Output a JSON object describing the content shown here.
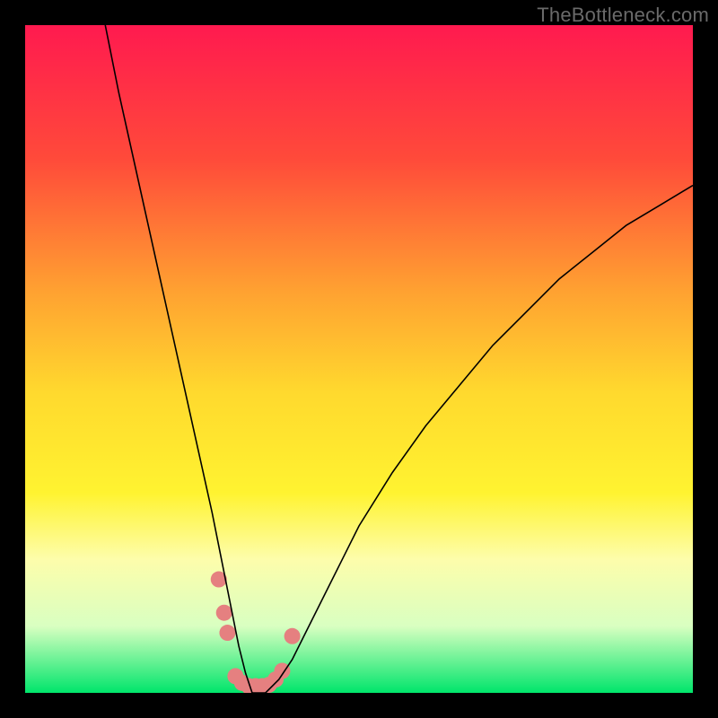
{
  "watermark": "TheBottleneck.com",
  "chart_data": {
    "type": "line",
    "title": "",
    "xlabel": "",
    "ylabel": "",
    "xlim": [
      0,
      100
    ],
    "ylim": [
      0,
      100
    ],
    "grid": false,
    "legend": false,
    "background_gradient_y_to_color": [
      [
        0,
        "#ff1a4f"
      ],
      [
        20,
        "#ff4a3a"
      ],
      [
        40,
        "#ffa231"
      ],
      [
        55,
        "#ffd92e"
      ],
      [
        70,
        "#fff330"
      ],
      [
        80,
        "#fdfdab"
      ],
      [
        90,
        "#d9ffc1"
      ],
      [
        100,
        "#00e56b"
      ]
    ],
    "series": [
      {
        "name": "bottleneck-curve",
        "color": "#000000",
        "stroke_width": 1.6,
        "x": [
          12,
          14,
          16,
          18,
          20,
          22,
          24,
          26,
          28,
          29,
          30,
          31,
          32,
          33,
          34,
          35,
          36,
          38,
          40,
          42,
          45,
          50,
          55,
          60,
          65,
          70,
          75,
          80,
          85,
          90,
          95,
          100
        ],
        "y": [
          100,
          90,
          81,
          72,
          63,
          54,
          45,
          36,
          27,
          22,
          17,
          12,
          7,
          3,
          0,
          0,
          0,
          2,
          5,
          9,
          15,
          25,
          33,
          40,
          46,
          52,
          57,
          62,
          66,
          70,
          73,
          76
        ]
      }
    ],
    "markers": [
      {
        "name": "dot-cluster",
        "color": "#e58080",
        "radius": 9,
        "points": [
          {
            "x": 29.0,
            "y": 17
          },
          {
            "x": 29.8,
            "y": 12
          },
          {
            "x": 30.3,
            "y": 9
          },
          {
            "x": 31.5,
            "y": 2.5
          },
          {
            "x": 32.5,
            "y": 1.5
          },
          {
            "x": 33.5,
            "y": 1.0
          },
          {
            "x": 34.5,
            "y": 1.0
          },
          {
            "x": 35.5,
            "y": 1.0
          },
          {
            "x": 36.5,
            "y": 1.2
          },
          {
            "x": 37.5,
            "y": 2.0
          },
          {
            "x": 38.5,
            "y": 3.3
          },
          {
            "x": 40.0,
            "y": 8.5
          }
        ]
      }
    ]
  }
}
